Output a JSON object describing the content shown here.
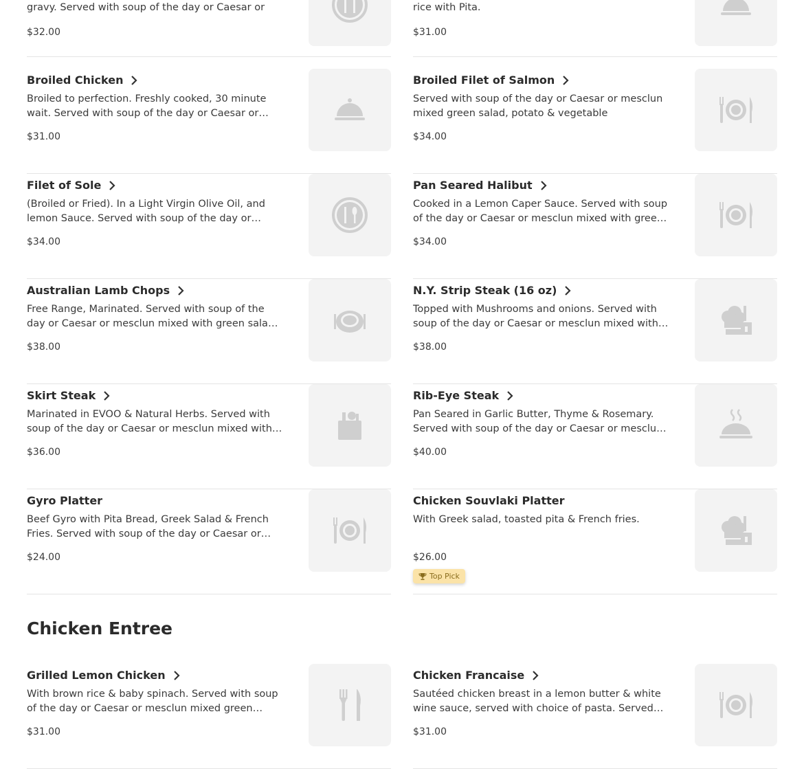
{
  "colors": {
    "badge_bg": "#fbe3a8",
    "thumb_bg": "#f3f3f3",
    "icon": "#cfcfcf"
  },
  "top_partial": {
    "left": {
      "desc": "gravy. Served with soup of the day or Caesar or",
      "price": "$32.00",
      "icon": "plate-cutlery-icon"
    },
    "right": {
      "desc": "rice with Pita.",
      "price": "$31.00",
      "icon": "cloche-icon"
    }
  },
  "items_left": [
    {
      "name": "Broiled Chicken",
      "desc": "Broiled to perfection. Freshly cooked, 30 minute wait. Served with soup of the day or Caesar or mesclun mixed green salad.",
      "price": "$31.00",
      "icon": "cloche-icon"
    },
    {
      "name": "Filet of Sole",
      "desc": "(Broiled or Fried). In a Light Virgin Olive Oil, and lemon Sauce. Served with soup of the day or Caesar or mesclun salad.",
      "price": "$34.00",
      "icon": "plate-cutlery-circle-icon"
    },
    {
      "name": "Australian Lamb Chops",
      "desc": "Free Range, Marinated. Served with soup of the day or Caesar or mesclun mixed with green salad, potato & vegetable.",
      "price": "$38.00",
      "icon": "dining-plate-icon"
    },
    {
      "name": "Skirt Steak",
      "desc": "Marinated in EVOO & Natural Herbs. Served with soup of the day or Caesar or mesclun mixed with green salad.",
      "price": "$36.00",
      "icon": "grocery-bag-icon"
    },
    {
      "name": "Gyro Platter",
      "desc": "Beef Gyro with Pita Bread, Greek Salad & French Fries. Served with soup of the day or Caesar or mesclun salad.",
      "price": "$24.00",
      "icon": "plate-fork-knife-icon"
    }
  ],
  "items_right": [
    {
      "name": "Broiled Filet of Salmon",
      "desc": "Served with soup of the day or Caesar or mesclun mixed green salad, potato & vegetable",
      "price": "$34.00",
      "icon": "plate-fork-knife-icon"
    },
    {
      "name": "Pan Seared Halibut",
      "desc": "Cooked in a Lemon Caper Sauce. Served with soup of the day or Caesar or mesclun mixed with green salad.",
      "price": "$34.00",
      "icon": "plate-fork-knife-icon"
    },
    {
      "name": "N.Y. Strip Steak (16 oz)",
      "desc": "Topped with Mushrooms and onions. Served with soup of the day or Caesar or mesclun mixed with green salad.",
      "price": "$38.00",
      "icon": "chef-hat-icon"
    },
    {
      "name": "Rib-Eye Steak",
      "desc": "Pan Seared in Garlic Butter, Thyme & Rosemary. Served with soup of the day or Caesar or mesclun salad.",
      "price": "$40.00",
      "icon": "hot-dish-icon"
    },
    {
      "name": "Chicken Souvlaki Platter",
      "desc": "With Greek salad, toasted pita & French fries.",
      "price": "$26.00",
      "icon": "chef-hat-icon",
      "badge": "Top Pick"
    }
  ],
  "section": {
    "title": "Chicken Entree",
    "items_left": [
      {
        "name": "Grilled Lemon Chicken",
        "desc": "With brown rice & baby spinach. Served with soup of the day or Caesar or mesclun mixed green salad.",
        "price": "$31.00",
        "icon": "fork-knife-icon"
      }
    ],
    "items_right": [
      {
        "name": "Chicken Francaise",
        "desc": "Sautéed chicken breast in a lemon butter & white wine sauce, served with choice of pasta. Served with soup of the day.",
        "price": "$31.00",
        "icon": "plate-fork-knife-icon"
      }
    ]
  }
}
